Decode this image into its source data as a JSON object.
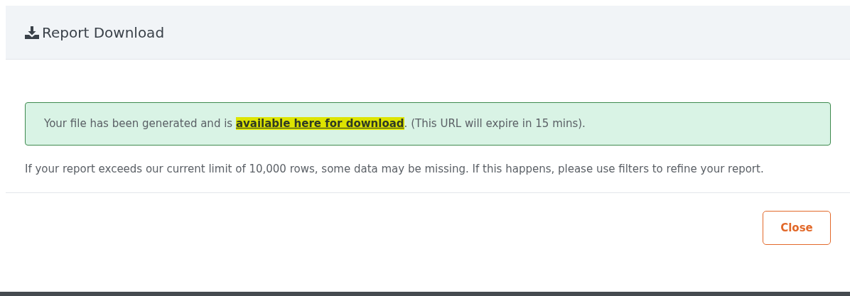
{
  "modal": {
    "title": "Report Download",
    "alert": {
      "before": "Your file has been generated and is ",
      "link": "available here for download",
      "after": ". (This URL will expire in 15 mins).",
      "link_highlighted": true
    },
    "note": "If your report exceeds our current limit of 10,000 rows, some data may be missing. If this happens, please use filters to refine your report.",
    "buttons": [
      {
        "label": "Close"
      }
    ]
  }
}
